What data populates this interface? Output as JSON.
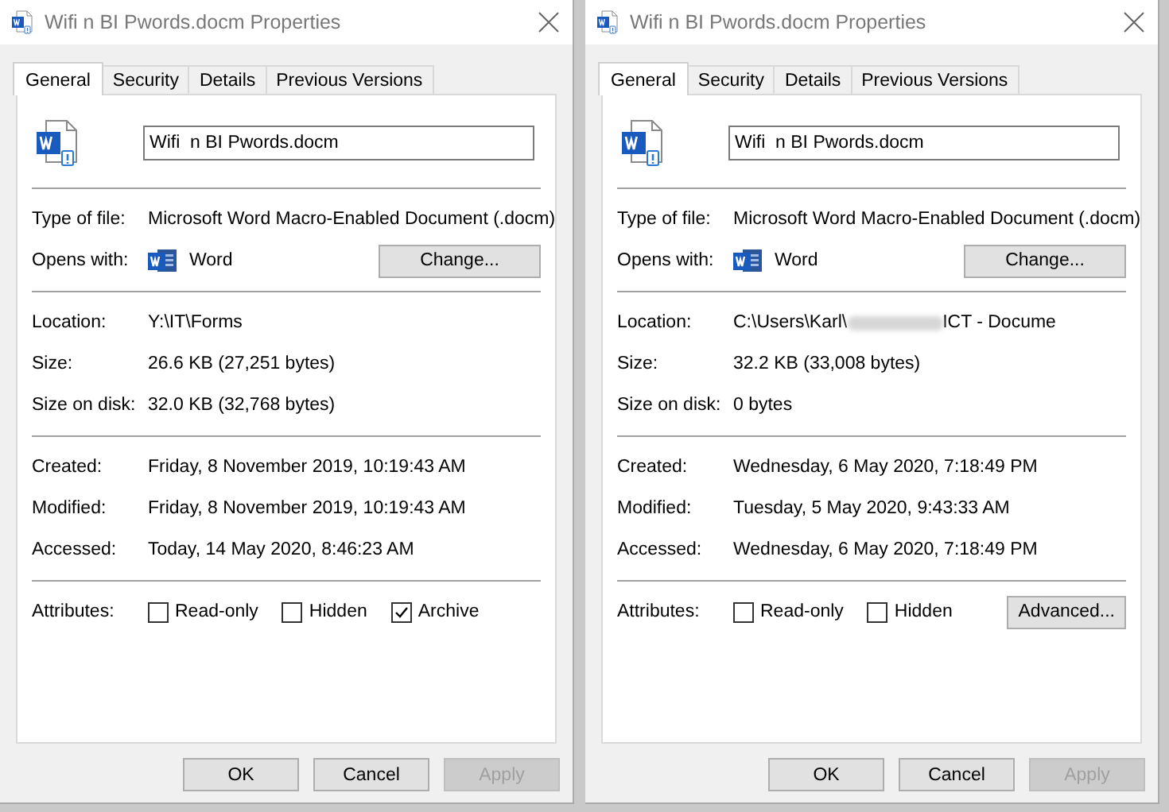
{
  "dialogs": [
    {
      "title": "Wifi  n BI Pwords.docm Properties",
      "tabs": [
        {
          "label": "General",
          "selected": true
        },
        {
          "label": "Security",
          "selected": false
        },
        {
          "label": "Details",
          "selected": false
        },
        {
          "label": "Previous Versions",
          "selected": false
        }
      ],
      "file_name": "Wifi  n BI Pwords.docm",
      "type_of_file": {
        "label": "Type of file:",
        "value": "Microsoft Word Macro-Enabled Document (.docm)"
      },
      "opens_with": {
        "label": "Opens with:",
        "app": "Word",
        "button": "Change..."
      },
      "file_info": [
        {
          "label": "Location:",
          "segments": [
            {
              "kind": "text",
              "text": "Y:\\IT\\Forms"
            }
          ]
        },
        {
          "label": "Size:",
          "segments": [
            {
              "kind": "text",
              "text": "26.6 KB (27,251 bytes)"
            }
          ]
        },
        {
          "label": "Size on disk:",
          "segments": [
            {
              "kind": "text",
              "text": "32.0 KB (32,768 bytes)"
            }
          ]
        }
      ],
      "dates": [
        {
          "label": "Created:",
          "value": "Friday, 8 November 2019, 10:19:43 AM"
        },
        {
          "label": "Modified:",
          "value": "Friday, 8 November 2019, 10:19:43 AM"
        },
        {
          "label": "Accessed:",
          "value": "Today, 14 May 2020, 8:46:23 AM"
        }
      ],
      "attributes": {
        "label": "Attributes:",
        "checkboxes": [
          {
            "label": "Read-only",
            "checked": false
          },
          {
            "label": "Hidden",
            "checked": false
          },
          {
            "label": "Archive",
            "checked": true
          }
        ]
      },
      "buttons": [
        {
          "label": "OK",
          "disabled": false
        },
        {
          "label": "Cancel",
          "disabled": false
        },
        {
          "label": "Apply",
          "disabled": true
        }
      ]
    },
    {
      "title": "Wifi  n BI Pwords.docm Properties",
      "tabs": [
        {
          "label": "General",
          "selected": true
        },
        {
          "label": "Security",
          "selected": false
        },
        {
          "label": "Details",
          "selected": false
        },
        {
          "label": "Previous Versions",
          "selected": false
        }
      ],
      "file_name": "Wifi  n BI Pwords.docm",
      "type_of_file": {
        "label": "Type of file:",
        "value": "Microsoft Word Macro-Enabled Document (.docm)"
      },
      "opens_with": {
        "label": "Opens with:",
        "app": "Word",
        "button": "Change..."
      },
      "file_info": [
        {
          "label": "Location:",
          "segments": [
            {
              "kind": "text",
              "text": "C:\\Users\\Karl\\"
            },
            {
              "kind": "redacted"
            },
            {
              "kind": "text",
              "text": "ICT - Docume"
            }
          ]
        },
        {
          "label": "Size:",
          "segments": [
            {
              "kind": "text",
              "text": "32.2 KB (33,008 bytes)"
            }
          ]
        },
        {
          "label": "Size on disk:",
          "segments": [
            {
              "kind": "text",
              "text": "0 bytes"
            }
          ]
        }
      ],
      "dates": [
        {
          "label": "Created:",
          "value": "Wednesday, 6 May 2020, 7:18:49 PM"
        },
        {
          "label": "Modified:",
          "value": "Tuesday, 5 May 2020, 9:43:33 AM"
        },
        {
          "label": "Accessed:",
          "value": "Wednesday, 6 May 2020, 7:18:49 PM"
        }
      ],
      "attributes": {
        "label": "Attributes:",
        "checkboxes": [
          {
            "label": "Read-only",
            "checked": false
          },
          {
            "label": "Hidden",
            "checked": false
          }
        ],
        "button": "Advanced..."
      },
      "buttons": [
        {
          "label": "OK",
          "disabled": false
        },
        {
          "label": "Cancel",
          "disabled": false
        },
        {
          "label": "Apply",
          "disabled": true
        }
      ]
    }
  ]
}
